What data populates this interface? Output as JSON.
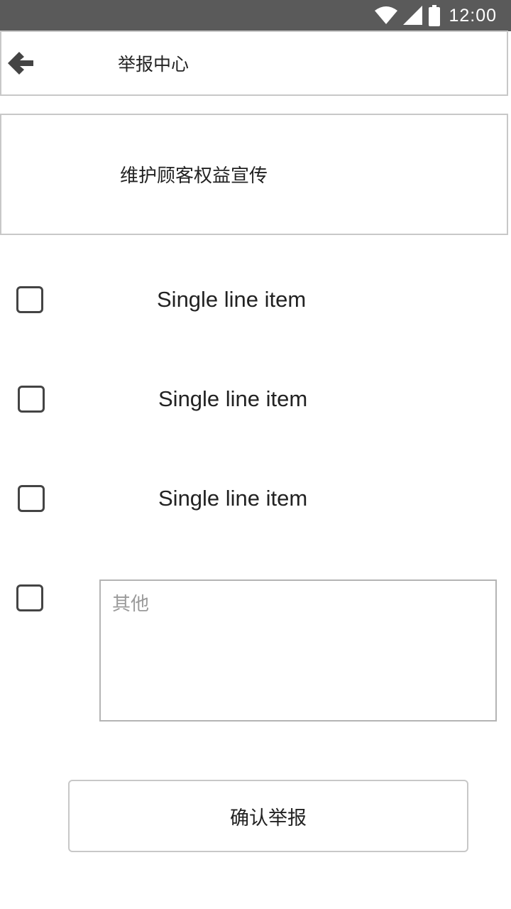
{
  "status_bar": {
    "time": "12:00",
    "icons": [
      "wifi-icon",
      "cell-signal-icon",
      "battery-icon"
    ]
  },
  "header": {
    "back_icon": "arrow-left-icon",
    "title": "举报中心"
  },
  "banner": {
    "text": "维护顾客权益宣传"
  },
  "report_options": {
    "items": [
      {
        "label": "Single line item",
        "checked": false
      },
      {
        "label": "Single line item",
        "checked": false
      },
      {
        "label": "Single line item",
        "checked": false
      }
    ],
    "other": {
      "checked": false,
      "placeholder": "其他",
      "value": ""
    }
  },
  "confirm_button": {
    "label": "确认举报"
  },
  "colors": {
    "status_bar_bg": "#5a5a5a",
    "border": "#c8c8c8",
    "text": "#222222",
    "placeholder": "#9a9a9a"
  }
}
